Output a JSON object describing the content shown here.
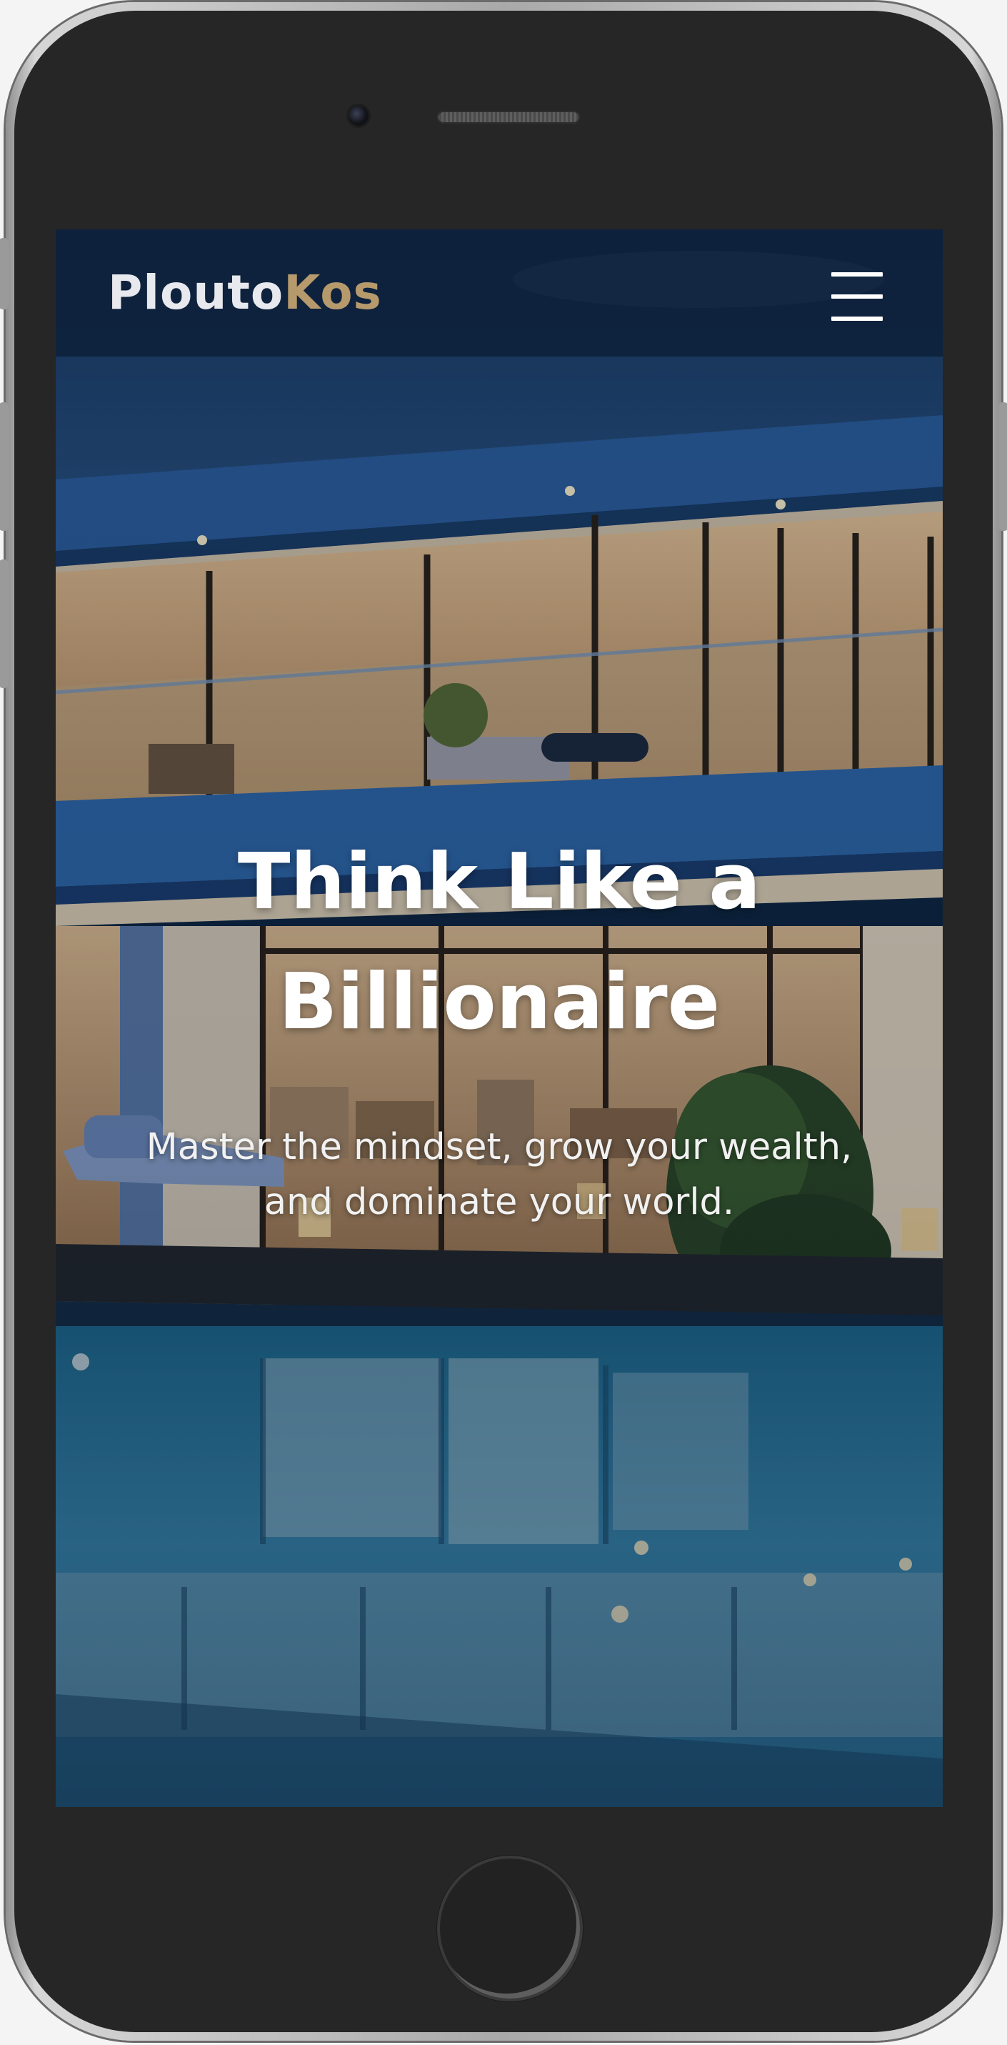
{
  "brand": {
    "part1": "Plouto",
    "part2": "Kos"
  },
  "hero": {
    "title": "Think Like a Billionaire",
    "subtitle": "Master the mindset, grow your wealth, and dominate your world."
  },
  "icons": {
    "menu": "hamburger-menu-icon"
  },
  "colors": {
    "brand_light": "#e7e9ee",
    "brand_accent": "#b69a6c",
    "nav_bg": "#0c1e36",
    "phone_body": "#262626"
  }
}
